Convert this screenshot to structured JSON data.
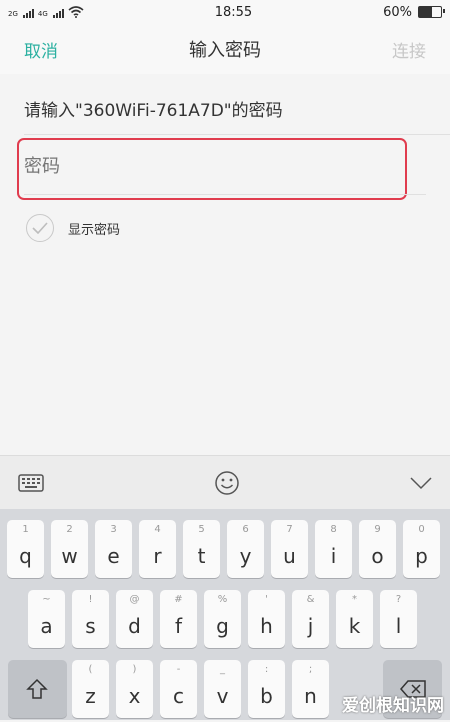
{
  "status": {
    "sim1_label": "2G",
    "sim2_label": "4G",
    "time": "18:55",
    "battery": "60%",
    "battery_level": 0.6
  },
  "nav": {
    "cancel": "取消",
    "title": "输入密码",
    "connect": "连接"
  },
  "prompt": "请输入\"360WiFi-761A7D\"的密码",
  "password": {
    "placeholder": "密码",
    "value": ""
  },
  "show_password_label": "显示密码",
  "keyboard": {
    "row1": [
      {
        "sub": "1",
        "main": "q"
      },
      {
        "sub": "2",
        "main": "w"
      },
      {
        "sub": "3",
        "main": "e"
      },
      {
        "sub": "4",
        "main": "r"
      },
      {
        "sub": "5",
        "main": "t"
      },
      {
        "sub": "6",
        "main": "y"
      },
      {
        "sub": "7",
        "main": "u"
      },
      {
        "sub": "8",
        "main": "i"
      },
      {
        "sub": "9",
        "main": "o"
      },
      {
        "sub": "0",
        "main": "p"
      }
    ],
    "row2": [
      {
        "sub": "~",
        "main": "a"
      },
      {
        "sub": "!",
        "main": "s"
      },
      {
        "sub": "@",
        "main": "d"
      },
      {
        "sub": "#",
        "main": "f"
      },
      {
        "sub": "%",
        "main": "g"
      },
      {
        "sub": "'",
        "main": "h"
      },
      {
        "sub": "&",
        "main": "j"
      },
      {
        "sub": "*",
        "main": "k"
      },
      {
        "sub": "?",
        "main": "l"
      }
    ],
    "row3": [
      {
        "sub": "(",
        "main": "z"
      },
      {
        "sub": ")",
        "main": "x"
      },
      {
        "sub": "-",
        "main": "c"
      },
      {
        "sub": "_",
        "main": "v"
      },
      {
        "sub": ":",
        "main": "b"
      },
      {
        "sub": ";",
        "main": "n"
      }
    ]
  },
  "watermark": "爱创根知识网"
}
